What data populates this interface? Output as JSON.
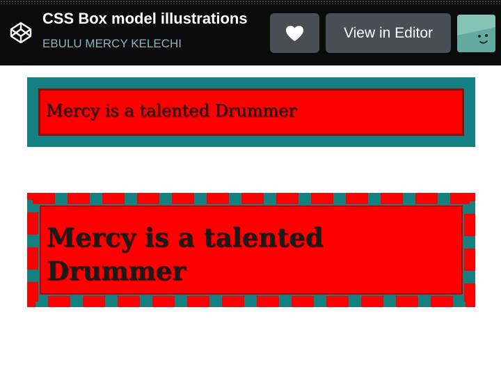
{
  "header": {
    "title": "CSS Box model illustrations",
    "author": "EBULU MERCY KELECHI",
    "logo_icon": "codepen-logo-icon",
    "like_icon": "heart-icon",
    "editor_button_label": "View in Editor",
    "avatar_icon": "avatar-face-icon"
  },
  "boxes": {
    "first_text": "Mercy is a talented Drummer",
    "second_text": "Mercy is a talented Drummer"
  },
  "colors": {
    "header_bg": "#0b0b0b",
    "button_bg": "#4b4d55",
    "author_text": "#8fb3c4",
    "teal": "#138181",
    "red": "#ff0000",
    "avatar_bg": "#6fb5a8"
  }
}
